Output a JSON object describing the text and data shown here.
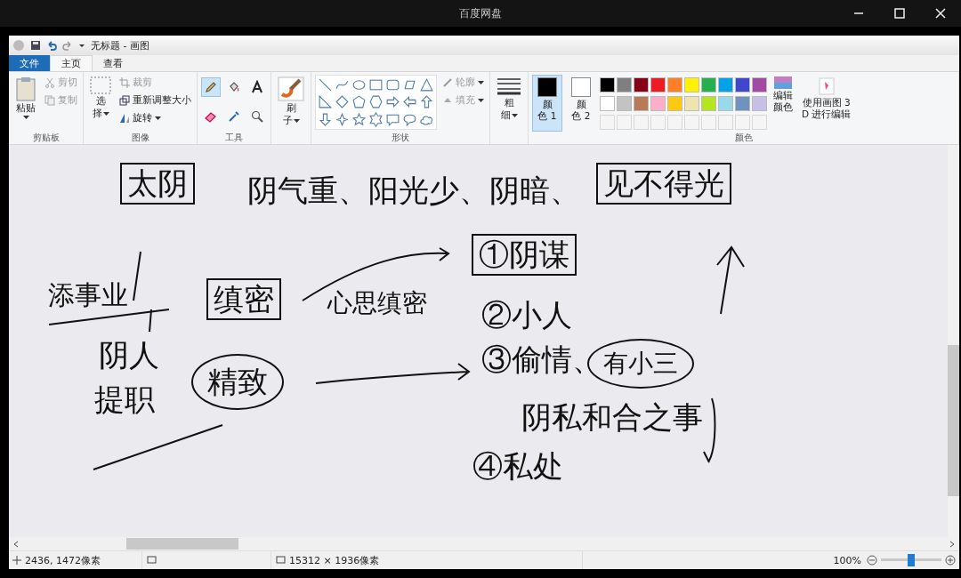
{
  "player": {
    "title": "百度网盘"
  },
  "paint": {
    "doc_title": "无标题 - 画图",
    "tabs": [
      {
        "label": "文件",
        "kind": "file",
        "selected": false
      },
      {
        "label": "主页",
        "kind": "tab",
        "selected": true
      },
      {
        "label": "查看",
        "kind": "tab",
        "selected": false
      }
    ],
    "clipboard": {
      "paste": "粘贴",
      "cut": {
        "label": "剪切",
        "disabled": true
      },
      "copy": {
        "label": "复制",
        "disabled": true
      },
      "group": "剪贴板"
    },
    "image": {
      "select": [
        "选",
        "择"
      ],
      "crop": {
        "label": "裁剪",
        "disabled": true
      },
      "resize": {
        "label": "重新调整大小",
        "disabled": false
      },
      "rotate": {
        "label": "旋转",
        "disabled": false
      },
      "group": "图像"
    },
    "tools": {
      "items": [
        {
          "kind": "pencil",
          "selected": true
        },
        {
          "kind": "fill",
          "selected": false
        },
        {
          "kind": "text",
          "selected": false
        },
        {
          "kind": "eraser",
          "selected": false
        },
        {
          "kind": "picker",
          "selected": false
        },
        {
          "kind": "magnifier",
          "selected": false
        }
      ],
      "group": "工具"
    },
    "brushes": {
      "label": [
        "刷",
        "子"
      ]
    },
    "shapes": {
      "outline": {
        "label": "轮廓",
        "disabled": true
      },
      "fill": {
        "label": "填充",
        "disabled": true
      },
      "group": "形状"
    },
    "size": {
      "label": [
        "粗",
        "细"
      ]
    },
    "colors": {
      "primary": {
        "label": [
          "颜",
          "色 1"
        ],
        "color": "#000000",
        "selected": true
      },
      "secondary": {
        "label": [
          "颜",
          "色 2"
        ],
        "color": "#ffffff",
        "selected": false
      },
      "palette": [
        {
          "color": "#000000"
        },
        {
          "color": "#7f7f7f"
        },
        {
          "color": "#880015"
        },
        {
          "color": "#ed1c24"
        },
        {
          "color": "#ff7f27"
        },
        {
          "color": "#fff200"
        },
        {
          "color": "#22b14c"
        },
        {
          "color": "#00a2e8"
        },
        {
          "color": "#3f48cc"
        },
        {
          "color": "#a349a4"
        },
        {
          "color": "#ffffff"
        },
        {
          "color": "#c3c3c3"
        },
        {
          "color": "#b97a57"
        },
        {
          "color": "#ffaec9"
        },
        {
          "color": "#ffc90e"
        },
        {
          "color": "#efe4b0"
        },
        {
          "color": "#b5e61d"
        },
        {
          "color": "#99d9ea"
        },
        {
          "color": "#7092be"
        },
        {
          "color": "#c8bfe7"
        }
      ],
      "edit": [
        "编辑",
        "颜色"
      ],
      "paint3d": [
        "使用画图 3",
        "D 进行编辑"
      ],
      "group": "颜色"
    },
    "canvas_notes": [
      {
        "text": "太阴",
        "kind": "boxed"
      },
      {
        "text": "阴气重、阳光少、阴暗、",
        "kind": "plain"
      },
      {
        "text": "见不得光",
        "kind": "boxed"
      },
      {
        "text": "添事业",
        "kind": "plain"
      },
      {
        "text": "缜密",
        "kind": "boxed"
      },
      {
        "text": "心思缜密",
        "kind": "plain"
      },
      {
        "text": "①阴谋",
        "kind": "boxed"
      },
      {
        "text": "②小人",
        "kind": "plain"
      },
      {
        "text": "③偷情、",
        "kind": "plain"
      },
      {
        "text": "有小三",
        "kind": "circled"
      },
      {
        "text": "阴私和合之事",
        "kind": "plain"
      },
      {
        "text": "④私处",
        "kind": "plain"
      },
      {
        "text": "阴人",
        "kind": "plain"
      },
      {
        "text": "提职",
        "kind": "plain"
      },
      {
        "text": "精致",
        "kind": "circled"
      }
    ],
    "status": {
      "cursor": "2436, 1472像素",
      "size": "15312 × 1936像素",
      "zoom": "100%",
      "zoom_level": {
        "level": 0.5
      }
    }
  }
}
